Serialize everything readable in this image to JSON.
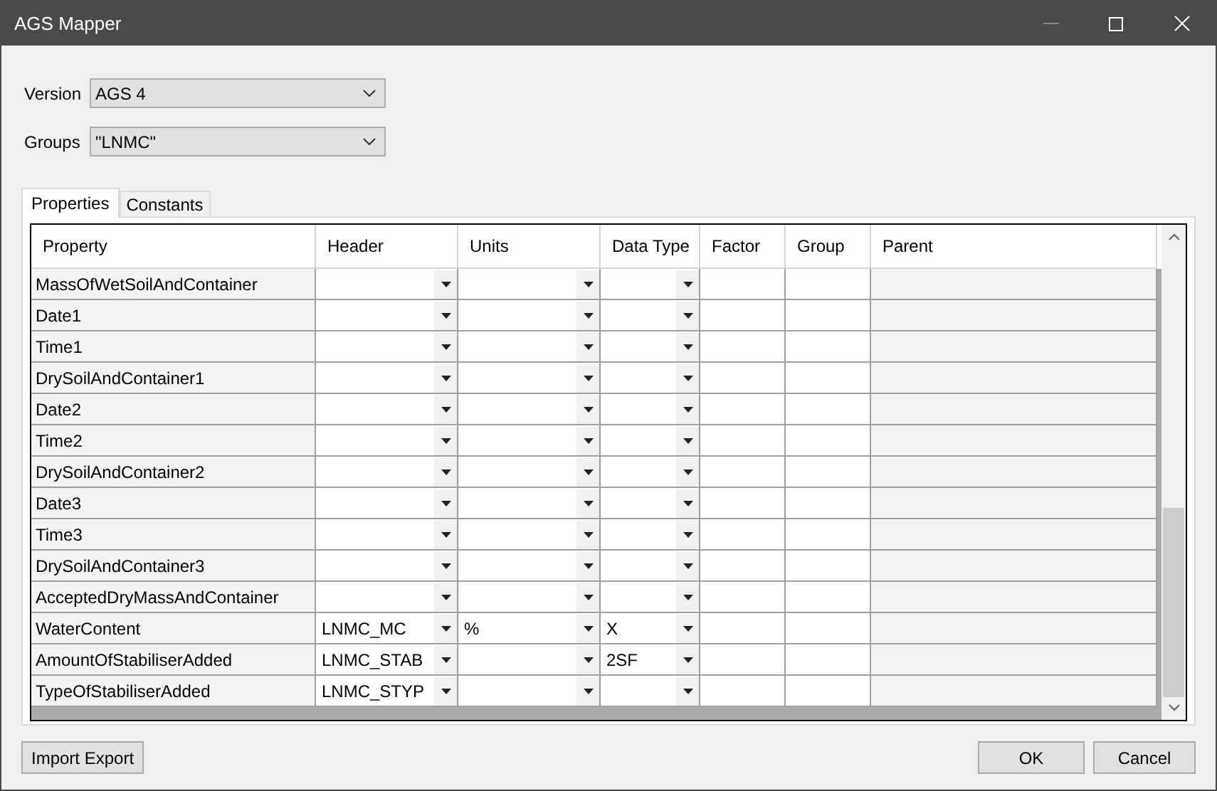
{
  "window": {
    "title": "AGS Mapper"
  },
  "version": {
    "label": "Version",
    "value": "AGS 4"
  },
  "groups": {
    "label": "Groups",
    "value": "\"LNMC\""
  },
  "tabs": [
    {
      "label": "Properties",
      "selected": true
    },
    {
      "label": "Constants",
      "selected": false
    }
  ],
  "table": {
    "columns": [
      "Property",
      "Header",
      "Units",
      "Data Type",
      "Factor",
      "Group",
      "Parent"
    ],
    "rows": [
      {
        "property": "MassOfWetSoilAndContainer"
      },
      {
        "property": "Date1"
      },
      {
        "property": "Time1"
      },
      {
        "property": "DrySoilAndContainer1"
      },
      {
        "property": "Date2"
      },
      {
        "property": "Time2"
      },
      {
        "property": "DrySoilAndContainer2"
      },
      {
        "property": "Date3"
      },
      {
        "property": "Time3"
      },
      {
        "property": "DrySoilAndContainer3"
      },
      {
        "property": "AcceptedDryMassAndContainer"
      },
      {
        "property": "WaterContent",
        "header": "LNMC_MC",
        "units": "%",
        "data_type": "X"
      },
      {
        "property": "AmountOfStabiliserAdded",
        "header": "LNMC_STAB",
        "data_type": "2SF"
      },
      {
        "property": "TypeOfStabiliserAdded",
        "header": "LNMC_STYP"
      }
    ]
  },
  "buttons": {
    "left": "Import Export",
    "ok": "OK",
    "cancel": "Cancel"
  }
}
